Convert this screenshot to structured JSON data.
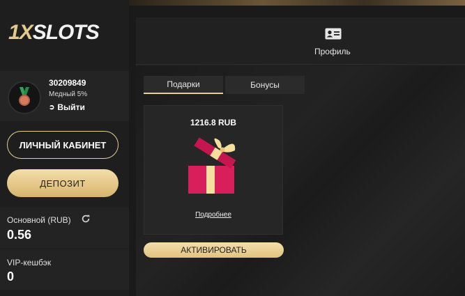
{
  "logo": {
    "prefix": "1X",
    "suffix": "SLOTS"
  },
  "user": {
    "id": "30209849",
    "level": "Медный 5%",
    "logout_label": "Выйти",
    "avatar_icon": "bronze-medal-icon"
  },
  "sidebar": {
    "cabinet_label": "ЛИЧНЫЙ КАБИНЕТ",
    "deposit_label": "ДЕПОЗИТ",
    "balance_label": "Основной (RUB)",
    "balance_value": "0.56",
    "vip_label": "VIP-кешбэк",
    "vip_value": "0"
  },
  "profile": {
    "label": "Профиль",
    "icon": "id-card-icon"
  },
  "tabs": [
    {
      "label": "Подарки",
      "active": true
    },
    {
      "label": "Бонусы",
      "active": false
    }
  ],
  "gift": {
    "amount": "1216.8 RUB",
    "icon": "gift-box-icon",
    "more_label": "Подробнее",
    "activate_label": "АКТИВИРОВАТЬ"
  },
  "colors": {
    "accent_gold": "#e6cf94",
    "gift_red": "#d81e5b",
    "gift_ribbon": "#f4df9c"
  }
}
